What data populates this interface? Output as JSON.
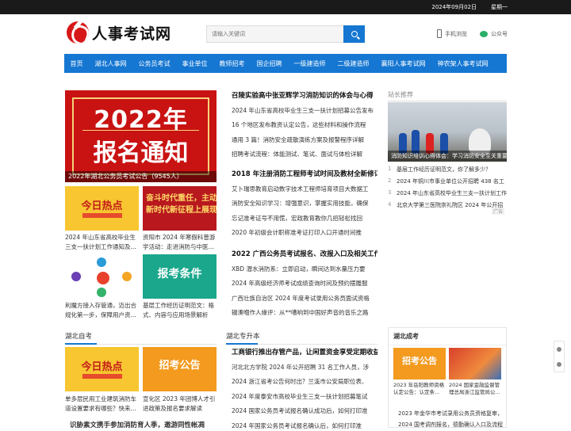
{
  "topbar": {
    "date": "2024年09月02日",
    "weekday": "星期一"
  },
  "logo": {
    "text": "人事考试网"
  },
  "search": {
    "placeholder": "请输入关键词"
  },
  "header_links": {
    "mobile": "手机浏览",
    "wechat": "公众号"
  },
  "nav": [
    "首页",
    "湖北人事网",
    "公务员考试",
    "事业单位",
    "教师招考",
    "国企招聘",
    "一级建造师",
    "二级建造师",
    "襄阳人事考试网",
    "神农架人事考试网"
  ],
  "hero": {
    "year": "2022年",
    "title": "报名通知",
    "caption": "2022年湖北公务员考试公告（9545人）"
  },
  "thumbs": [
    {
      "img_text": "今日热点",
      "caption": "2024 年山东省高校毕业生三支一扶计划工作通知及..."
    },
    {
      "img_text": "奋斗时代重任，主动担当",
      "img_text2": "新时代新征程上展现新",
      "caption": "资阳市 2024 年寒假科普游学活动：走进消防与中医..."
    },
    {
      "img_text": "",
      "caption": "利魔方接入存管通，迈出合规化第一步，保障用户资..."
    },
    {
      "img_text": "报考条件",
      "caption": "基层工作经历证明范文：格式、内容与应用场景解析"
    }
  ],
  "mid_groups": [
    {
      "head": "召陵实验高中张亚辉学习消防知识的体会与心得",
      "items": [
        "2024 年山东省高校毕业生三支一扶计划招募公告发布",
        "16 个地区发布教资认定公告，这些材料和操作流程",
        "通用 3 篇！消防安全疏散演练方案及报警程序详解",
        "招聘考试流程：体能测试、笔试、面试与体检详解"
      ]
    },
    {
      "head": "2018 年注册消防工程师考试时间及教材全新修订",
      "items": [
        "艾卜瑞思教育启动数字技术工程师培育项目大数据工",
        "消防安全知识学习：增强意识，掌握实用技能，确保",
        "忘记准考证号不用慌，宏政教育教你几招轻松找回",
        "2020 年初级会计职称准考证打印入口开通时间推"
      ]
    },
    {
      "head": "2022 广西公务员考试报名、改报入口及相关工作",
      "items": [
        "XBD 潜水消防系：立即启动，瞬间达到水量压力要",
        "2024 年高级经济师考试成绩查询时间及预约摆履服",
        "广西壮族自治区 2024 年度考试录用公务员面试资格",
        "辍湊嗰作人缘评：从**嘈响到中国好声音的音乐之路"
      ]
    }
  ],
  "right": {
    "title": "站长推荐",
    "photo_caption": "消防知识培训心得体会：学习消防安全至关重要，",
    "ranks": [
      {
        "n": "1",
        "t": "基层工作经历证明范文，你了解多少？"
      },
      {
        "n": "2",
        "t": "2024 年铜川市事业单位公开招聘 438 名工"
      },
      {
        "n": "3",
        "t": "2024 年山东省高校毕业生三支一扶计划工作"
      },
      {
        "n": "4",
        "t": "北京大学第三医院崇礼院区 2024 年公开招"
      }
    ],
    "ad": "广告"
  },
  "hubei_zikao": {
    "title": "湖北自考",
    "thumbs": [
      {
        "img_text": "今日热点",
        "caption": "单多层民用工业建筑消防车道设置要求有哪些？快来..."
      },
      {
        "img_text": "招考公告",
        "caption": "宣化区 2023 年团博人才引进政策及报名要求解读"
      }
    ],
    "more": "识胁素文携手参加消防育人季，邀游同性帐凋"
  },
  "hubei_zsb": {
    "title": "湖北专升本",
    "head": "工商银行推出存管产品，让闲置资金享受定期收益",
    "items": [
      "河北北方学院 2024 年公开招聘 31 名工作人员，涉",
      "2024 浙江省考公告何时出？兰溪市公安局职位表、",
      "2024 年度泰安市高校毕业生三支一扶计划招募笔试",
      "2024 国家公务员考试报名确认成功后，如何打印准",
      "2024 年国家公务员考试报名确认后，如何打印准"
    ]
  },
  "hubei_chengkao": {
    "title": "湖北成考",
    "thumbs": [
      {
        "img_text": "招考公告",
        "caption": "2023 年岳阳教师资格认定公告：认定条..."
      },
      {
        "img_text": "",
        "caption": "2024 国家金融监督管理总局浙江监管局公..."
      }
    ],
    "items": [
      "2023 年金华市考试录用公务员资格复审，",
      "2024 国考调剂报名，德勤确认入口及流程"
    ]
  }
}
